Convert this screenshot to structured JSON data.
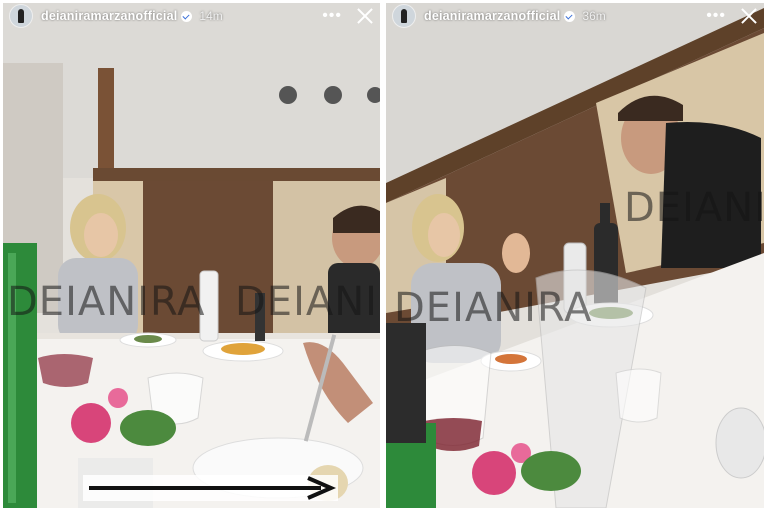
{
  "stories": [
    {
      "username": "deianiramarzanofficial",
      "time": "14m",
      "watermark": [
        "DEIANIRA",
        "DEIANIRA"
      ]
    },
    {
      "username": "deianiramarzanofficial",
      "time": "36m",
      "watermark": [
        "DEIANIRA",
        "DEIANIRA"
      ]
    }
  ],
  "icons": {
    "more": "more-icon",
    "close": "close-icon",
    "verified": "verified-badge-icon",
    "arrow": "right-arrow-icon"
  },
  "colors": {
    "wall_brown": "#6b4a34",
    "table_white": "#f3f1ee",
    "header_text": "#ffffff"
  }
}
